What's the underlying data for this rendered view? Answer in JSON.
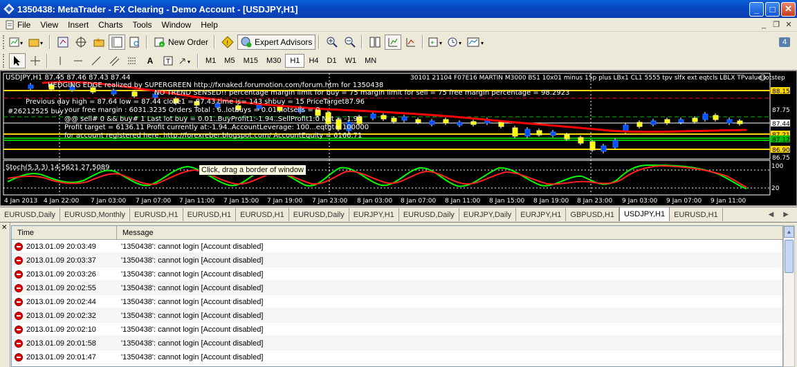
{
  "window": {
    "title": "1350438: MetaTrader - FX Clearing - Demo Account - [USDJPY,H1]",
    "controls": {
      "minimize": "_",
      "maximize": "□",
      "close": "✕"
    }
  },
  "menu": {
    "items": [
      "File",
      "View",
      "Insert",
      "Charts",
      "Tools",
      "Window",
      "Help"
    ]
  },
  "toolbar": {
    "new_order": "New Order",
    "expert_advisors": "Expert Advisors",
    "notification_count": "4"
  },
  "timeframes": {
    "items": [
      "M1",
      "M5",
      "M15",
      "M30",
      "H1",
      "H4",
      "D1",
      "W1",
      "MN"
    ],
    "active": "H1"
  },
  "chart": {
    "header_left": "USDJPY,H1  87.45 87.46 87.43 87.44",
    "header_right": "30101 21104 F07E16 MARTIN M3000 BS1 10x01 minus 15p plus LBx1 CL1 5555 tpv slfx ext eqtcls LBLX TPvalue lotstep",
    "overlay_lines": [
      "HEDGING EDGE realized by SUPERGREEN http://fxnaked.forumotion.com/forum.htm for 1350438",
      "NO TREND SENSED!! percentage margin limit for buy = 75 margin limit for sell = 75 free margin percentage = 98.2923",
      "Previous day high = 87.64 low = 87.44 close1 = 87.43 time is= 143 shbuy = 15 PriceTarget87.96",
      "your free margin : 6031.3235 Orders Total : 6..lotbuys = 0.01..lotsells = 0",
      "@@ sell# 0 && buy# 1 Last lot buy = 0.01..BuyProfit1:-1.94..SellProfit1:0 Net = -1.94",
      "Profit target = 6136.11 Profit currently at:-1.94..AccountLeverage: 100...eqtgt= 100000",
      "for account registered here: http://forexreber.blogspot.com/ AccountEquity = 6166.71"
    ],
    "order_label": "#26212525 buy",
    "price_labels": [
      "88.15",
      "87.75",
      "87.44",
      "87.21",
      "87.12",
      "86.90",
      "86.75"
    ],
    "highlight_prices": {
      "87.44": "#ffffff",
      "88.15": "#ffd700",
      "87.21": "#ffd700",
      "87.12": "#00c000",
      "86.90": "#ffd700"
    },
    "stoch_label": "Stoch(5,3,3) 14.5621 27.5089",
    "stoch_levels": [
      "100",
      "80",
      "20"
    ],
    "time_labels": [
      "4 Jan 2013",
      "4 Jan 22:00",
      "7 Jan 03:00",
      "7 Jan 07:00",
      "7 Jan 11:00",
      "7 Jan 15:00",
      "7 Jan 19:00",
      "7 Jan 23:00",
      "8 Jan 03:00",
      "8 Jan 07:00",
      "8 Jan 11:00",
      "8 Jan 15:00",
      "8 Jan 19:00",
      "8 Jan 23:00",
      "9 Jan 03:00",
      "9 Jan 07:00",
      "9 Jan 11:00"
    ],
    "tooltip": "Click, drag a border of window",
    "colors": {
      "ma": "#ff0000",
      "stoch_main": "#00ff00",
      "stoch_signal": "#ff0000",
      "bull": "#0050ff",
      "bear": "#ffff00"
    }
  },
  "chart_tabs": {
    "items": [
      "EURUSD,Daily",
      "EURUSD,Monthly",
      "EURUSD,H1",
      "EURUSD,H1",
      "EURUSD,H1",
      "EURUSD,Daily",
      "EURJPY,H1",
      "EURUSD,Daily",
      "EURJPY,Daily",
      "EURJPY,H1",
      "GBPUSD,H1",
      "USDJPY,H1",
      "EURUSD,H1"
    ],
    "active_index": 11
  },
  "terminal": {
    "columns": [
      "Time",
      "Message"
    ],
    "rows": [
      {
        "time": "2013.01.09 20:03:49",
        "message": "'1350438': cannot login [Account disabled]"
      },
      {
        "time": "2013.01.09 20:03:37",
        "message": "'1350438': cannot login [Account disabled]"
      },
      {
        "time": "2013.01.09 20:03:26",
        "message": "'1350438': cannot login [Account disabled]"
      },
      {
        "time": "2013.01.09 20:02:55",
        "message": "'1350438': cannot login [Account disabled]"
      },
      {
        "time": "2013.01.09 20:02:44",
        "message": "'1350438': cannot login [Account disabled]"
      },
      {
        "time": "2013.01.09 20:02:32",
        "message": "'1350438': cannot login [Account disabled]"
      },
      {
        "time": "2013.01.09 20:02:10",
        "message": "'1350438': cannot login [Account disabled]"
      },
      {
        "time": "2013.01.09 20:01:58",
        "message": "'1350438': cannot login [Account disabled]"
      },
      {
        "time": "2013.01.09 20:01:47",
        "message": "'1350438': cannot login [Account disabled]"
      }
    ]
  }
}
